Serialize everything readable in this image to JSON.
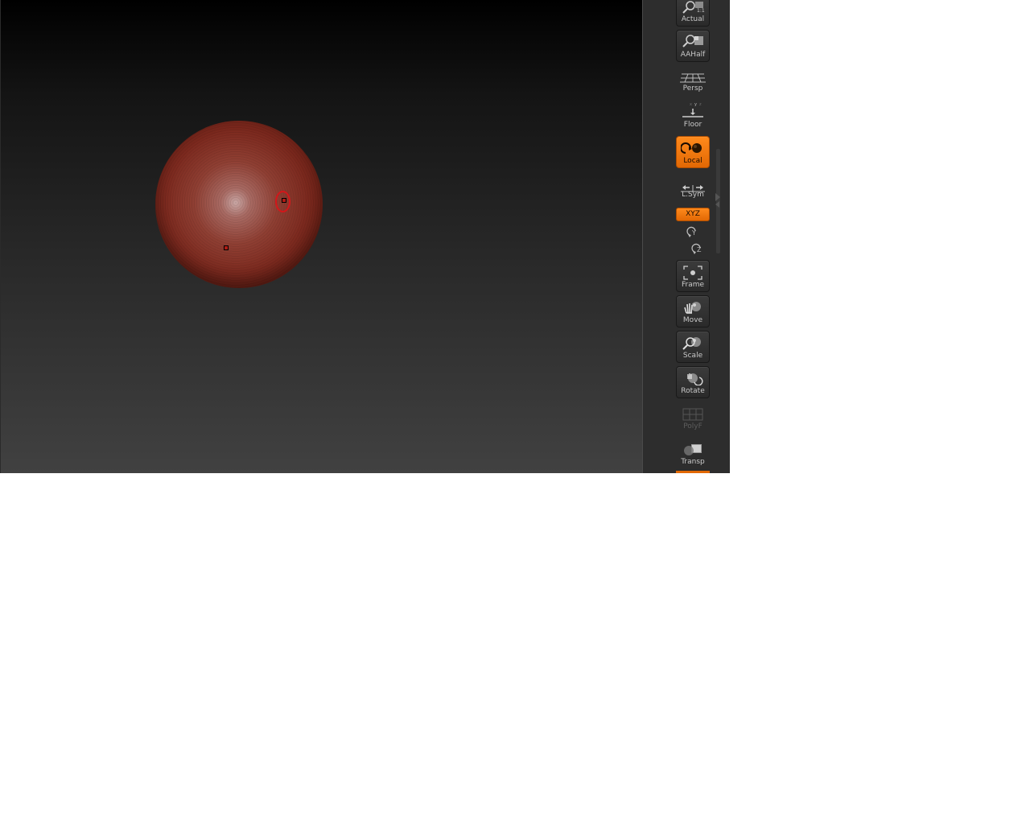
{
  "viewport": {
    "background_top": "#000000",
    "background_bottom": "#414141",
    "mesh_color": "#8f3f33",
    "cursor_color": "#d4161a"
  },
  "shelf": {
    "buttons": [
      {
        "id": "actual",
        "label": "Actual",
        "icon": "magnify-actual-icon"
      },
      {
        "id": "aahalf",
        "label": "AAHalf",
        "icon": "magnify-aahalf-icon"
      },
      {
        "id": "persp",
        "label": "Persp",
        "icon": "perspective-grid-icon"
      },
      {
        "id": "floor",
        "label": "Floor",
        "icon": "floor-icon"
      },
      {
        "id": "local",
        "label": "Local",
        "icon": "local-rotate-icon",
        "active": true
      },
      {
        "id": "lsym",
        "label": "L.Sym",
        "icon": "local-symmetry-icon"
      },
      {
        "id": "frame",
        "label": "Frame",
        "icon": "frame-icon"
      },
      {
        "id": "move",
        "label": "Move",
        "icon": "move-hand-icon"
      },
      {
        "id": "scale",
        "label": "Scale",
        "icon": "scale-magnify-icon"
      },
      {
        "id": "rotate",
        "label": "Rotate",
        "icon": "rotate-icon"
      },
      {
        "id": "polyf",
        "label": "PolyF",
        "icon": "polyframe-icon",
        "disabled": true
      },
      {
        "id": "transp",
        "label": "Transp",
        "icon": "transparency-icon"
      }
    ],
    "rotation_axis": {
      "label": "XYZ",
      "active": true
    },
    "axis_y": {
      "label": "Y"
    },
    "axis_z": {
      "label": "Z"
    },
    "accent_color": "#e26804"
  }
}
